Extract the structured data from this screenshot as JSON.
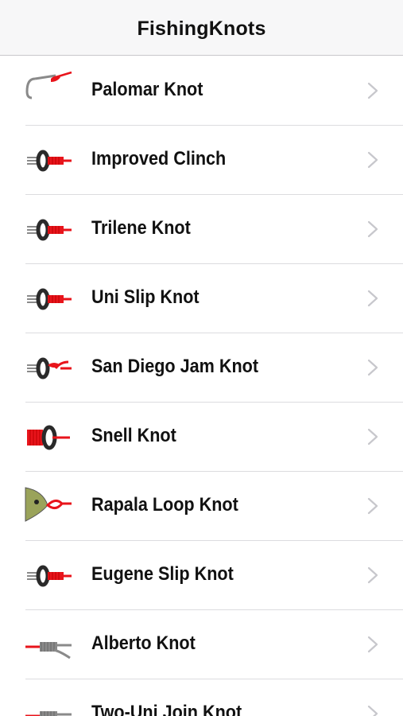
{
  "app": {
    "title": "FishingKnots"
  },
  "knots": [
    {
      "label": "Palomar Knot",
      "icon": "hook-knot-icon"
    },
    {
      "label": "Improved Clinch",
      "icon": "eye-clinch-icon"
    },
    {
      "label": "Trilene Knot",
      "icon": "eye-clinch-icon"
    },
    {
      "label": "Uni Slip Knot",
      "icon": "eye-clinch-icon"
    },
    {
      "label": "San Diego Jam Knot",
      "icon": "eye-jam-icon"
    },
    {
      "label": "Snell Knot",
      "icon": "snell-ring-icon"
    },
    {
      "label": "Rapala Loop Knot",
      "icon": "lure-loop-icon"
    },
    {
      "label": "Eugene Slip Knot",
      "icon": "eye-clinch-icon"
    },
    {
      "label": "Alberto Knot",
      "icon": "line-join-icon"
    },
    {
      "label": "Two-Uni Join Knot",
      "icon": "line-join-icon"
    }
  ],
  "colors": {
    "knot_red": "#e8141b",
    "ring_dark": "#2a2a2a",
    "line_grey": "#8a8a8a",
    "chevron": "#c7c7cc"
  }
}
